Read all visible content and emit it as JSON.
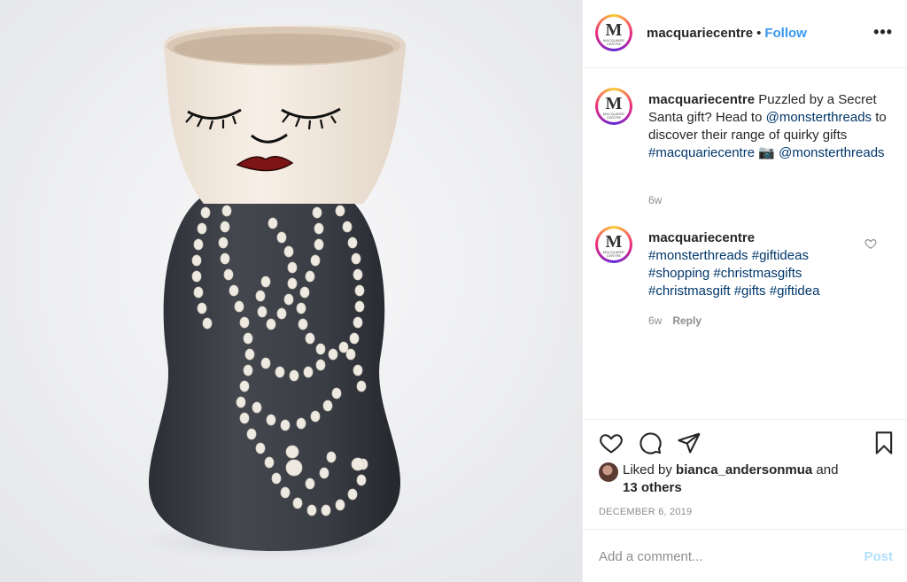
{
  "post": {
    "username": "macquariecentre",
    "follow_label": "Follow",
    "separator": "•",
    "more_label": "•••",
    "avatar_logo": "M",
    "avatar_sub": "MACQUARIE CENTRE"
  },
  "caption": {
    "username": "macquariecentre",
    "text_1": " Puzzled by a Secret Santa gift? Head to ",
    "mention_1": "@monsterthreads",
    "text_2": " to discover their range of quirky gifts ",
    "hashtag_1": "#macquariecentre",
    "camera": " 📷 ",
    "mention_2": "@monsterthreads",
    "time": "6w"
  },
  "comment": {
    "username": "macquariecentre",
    "tags": [
      "#monsterthreads",
      "#giftideas",
      "#shopping",
      "#christmasgifts",
      "#christmasgift",
      "#gifts",
      "#giftidea"
    ],
    "time": "6w",
    "reply_label": "Reply"
  },
  "likes": {
    "prefix": "Liked by ",
    "user": "bianca_andersonmua",
    "suffix": " and",
    "others": "13 others"
  },
  "date": "DECEMBER 6, 2019",
  "add_comment": {
    "placeholder": "Add a comment...",
    "post_label": "Post"
  },
  "colors": {
    "link": "#00376b",
    "follow": "#3897f0",
    "muted": "#8e8e8e",
    "vase_body": "#3a3d44",
    "vase_head": "#f3e9df"
  }
}
